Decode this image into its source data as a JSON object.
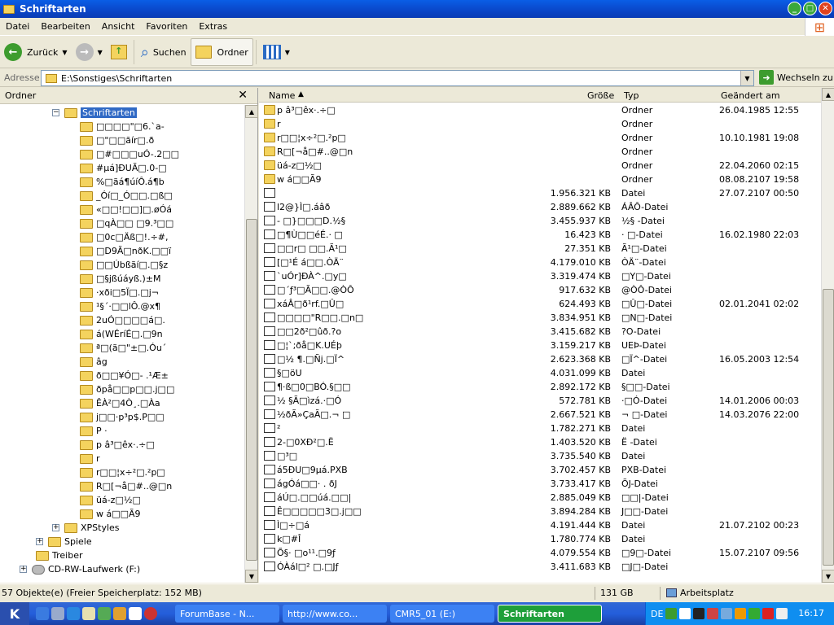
{
  "window": {
    "title": "Schriftarten"
  },
  "menu": [
    "Datei",
    "Bearbeiten",
    "Ansicht",
    "Favoriten",
    "Extras"
  ],
  "toolbar": {
    "back": "Zurück",
    "search": "Suchen",
    "folders": "Ordner"
  },
  "address": {
    "label": "Adresse",
    "value": "E:\\Sonstiges\\Schriftarten",
    "go": "Wechseln zu"
  },
  "folderpane": {
    "title": "Ordner"
  },
  "tree": [
    {
      "label": "Schriftarten",
      "level": 1,
      "selected": true,
      "exp": "−"
    },
    {
      "label": "□□□□\"□6.`a-",
      "level": 2
    },
    {
      "label": "□\"□□ãír□.ð",
      "level": 2
    },
    {
      "label": "□#□□□uÓ-.2□□",
      "level": 2
    },
    {
      "label": "#µá]ÐUÃ□.0-□",
      "level": 2
    },
    {
      "label": "%□ãá¶úíÔ.á¶b",
      "level": 2
    },
    {
      "label": "_Óí□_Ó□□.□ß□",
      "level": 2
    },
    {
      "label": "«□□!□□]□.øÓá",
      "level": 2
    },
    {
      "label": "□qÀ□□ □9.³□□",
      "level": 2
    },
    {
      "label": "□0c□Äß□!.÷#,",
      "level": 2
    },
    {
      "label": "□D9Ã□nðK.□□ï",
      "level": 2
    },
    {
      "label": "□□Úbßãí□.□§z",
      "level": 2
    },
    {
      "label": "□§jßúáyß.)±M",
      "level": 2
    },
    {
      "label": "·xði□5Ï□.□j¬",
      "level": 2
    },
    {
      "label": "¹§´·□□lÔ.@x¶",
      "level": 2
    },
    {
      "label": "2uÓ□□□□á□.",
      "level": 2
    },
    {
      "label": "á(WÉríÉ□.□9n",
      "level": 2
    },
    {
      "label": "ª□(ã□\"±□.Óu´",
      "level": 2
    },
    {
      "label": "âg",
      "level": 2
    },
    {
      "label": "ð□□¥Ó□- .¹Æ±",
      "level": 2
    },
    {
      "label": "ðpå□□p□□.j□□",
      "level": 2
    },
    {
      "label": "ÊÀ²□4Ò¸.□Àa",
      "level": 2
    },
    {
      "label": "j□□·p³p$.P□□",
      "level": 2
    },
    {
      "label": "P ·",
      "level": 2
    },
    {
      "label": "p â³□êx·.÷□",
      "level": 2
    },
    {
      "label": "r",
      "level": 2
    },
    {
      "label": "r□□¦x÷²□.²p□",
      "level": 2
    },
    {
      "label": "R□[¬å□#..@□n",
      "level": 2
    },
    {
      "label": "üá-z□½□",
      "level": 2
    },
    {
      "label": "w á□□Ã9",
      "level": 2
    },
    {
      "label": "XPStyles",
      "level": 1,
      "exp": "+"
    },
    {
      "label": "Spiele",
      "level": 0,
      "exp": "+"
    },
    {
      "label": "Treiber",
      "level": 0
    },
    {
      "label": "CD-RW-Laufwerk (F:)",
      "level": -1,
      "exp": "+",
      "drive": true
    }
  ],
  "columns": {
    "name": "Name",
    "size": "Größe",
    "type": "Typ",
    "modified": "Geändert am"
  },
  "files": [
    {
      "name": "p â³□êx·.÷□",
      "size": "",
      "type": "Ordner",
      "date": "26.04.1985 12:55",
      "folder": true
    },
    {
      "name": "r",
      "size": "",
      "type": "Ordner",
      "date": "",
      "folder": true
    },
    {
      "name": "r□□¦x÷²□.²p□",
      "size": "",
      "type": "Ordner",
      "date": "10.10.1981 19:08",
      "folder": true
    },
    {
      "name": "R□[¬å□#..@□n",
      "size": "",
      "type": "Ordner",
      "date": "",
      "folder": true
    },
    {
      "name": "üá-z□½□",
      "size": "",
      "type": "Ordner",
      "date": "22.04.2060 02:15",
      "folder": true
    },
    {
      "name": "w á□□Ã9",
      "size": "",
      "type": "Ordner",
      "date": "08.08.2107 19:58",
      "folder": true
    },
    {
      "name": "",
      "size": "1.956.321 KB",
      "type": "Datei",
      "date": "27.07.2107 00:50"
    },
    {
      "name": "l2@}Ì□.áâð",
      "size": "2.889.662 KB",
      "type": "ÁÂÔ-Datei",
      "date": ""
    },
    {
      "name": "- □}□□□D.½§",
      "size": "3.455.937 KB",
      "type": "½§ -Datei",
      "date": ""
    },
    {
      "name": "□¶Ù□□éÉ.· □",
      "size": "16.423 KB",
      "type": "· □-Datei",
      "date": "16.02.1980 22:03"
    },
    {
      "name": "□□r□ □□.Ã¹□",
      "size": "27.351 KB",
      "type": "Ã¹□-Datei",
      "date": ""
    },
    {
      "name": "[□¹É á□□.ÒÄ¨",
      "size": "4.179.010 KB",
      "type": "ÒÄ¨-Datei",
      "date": ""
    },
    {
      "name": "`uÓr]ÐÀ^.□y□",
      "size": "3.319.474 KB",
      "type": "□Y□-Datei",
      "date": ""
    },
    {
      "name": "□´ƒ³□Ã□□.@ÒÔ",
      "size": "917.632 KB",
      "type": "@ÒÔ-Datei",
      "date": ""
    },
    {
      "name": "xáÂ□ð¹rf.□Û□",
      "size": "624.493 KB",
      "type": "□Û□-Datei",
      "date": "02.01.2041 02:02"
    },
    {
      "name": "□□□□\"R□□.□n□",
      "size": "3.834.951 KB",
      "type": "□N□-Datei",
      "date": ""
    },
    {
      "name": "□□2ð²□ûð.?o",
      "size": "3.415.682 KB",
      "type": "?O-Datei",
      "date": ""
    },
    {
      "name": "□¦`;ðå□K.UÉþ",
      "size": "3.159.217 KB",
      "type": "UEÞ-Datei",
      "date": ""
    },
    {
      "name": "□½ ¶.□Ñj.□Ï^",
      "size": "2.623.368 KB",
      "type": "□Ï^-Datei",
      "date": "16.05.2003 12:54"
    },
    {
      "name": "§□öU",
      "size": "4.031.099 KB",
      "type": "Datei",
      "date": ""
    },
    {
      "name": "¶·ß□0□BÓ.§□□",
      "size": "2.892.172 KB",
      "type": "§□□-Datei",
      "date": ""
    },
    {
      "name": "½ §Ã□ìzá.·□Ó",
      "size": "572.781 KB",
      "type": "·□Ó-Datei",
      "date": "14.01.2006 00:03"
    },
    {
      "name": "½ðÃ»ÇaÃ□.¬ □",
      "size": "2.667.521 KB",
      "type": "¬ □-Datei",
      "date": "14.03.2076 22:00"
    },
    {
      "name": "²",
      "size": "1.782.271 KB",
      "type": "Datei",
      "date": ""
    },
    {
      "name": "2-□0XÐ²□.Ë",
      "size": "1.403.520 KB",
      "type": "Ë -Datei",
      "date": ""
    },
    {
      "name": "□³□",
      "size": "3.735.540 KB",
      "type": "Datei",
      "date": ""
    },
    {
      "name": "á5ÐU□9µá.PXB",
      "size": "3.702.457 KB",
      "type": "PXB-Datei",
      "date": ""
    },
    {
      "name": "ágÓá□□· . ðJ",
      "size": "3.733.417 KB",
      "type": "ÕJ-Datei",
      "date": ""
    },
    {
      "name": "áÚ□.□□úá.□□|",
      "size": "2.885.049 KB",
      "type": "□□|-Datei",
      "date": ""
    },
    {
      "name": "Ê□□□□□3□.j□□",
      "size": "3.894.284 KB",
      "type": "J□□-Datei",
      "date": ""
    },
    {
      "name": "Ì□÷□á",
      "size": "4.191.444 KB",
      "type": "Datei",
      "date": "21.07.2102 00:23"
    },
    {
      "name": "k□#Î",
      "size": "1.780.774 KB",
      "type": "Datei",
      "date": ""
    },
    {
      "name": "Õ§· □o¹¹.□9ƒ",
      "size": "4.079.554 KB",
      "type": "□9□-Datei",
      "date": "15.07.2107 09:56"
    },
    {
      "name": "ÓÀál□² □.□Jƒ",
      "size": "3.411.683 KB",
      "type": "□J□-Datei",
      "date": ""
    }
  ],
  "status": {
    "objects": "57 Objekte(e) (Freier Speicherplatz: 152 MB)",
    "size": "131 GB",
    "location": "Arbeitsplatz"
  },
  "taskbar": {
    "tasks": [
      "ForumBase - N...",
      "http://www.co...",
      "CMR5_01 (E:)",
      "Schriftarten"
    ],
    "lang": "DE",
    "clock": "16:17"
  }
}
